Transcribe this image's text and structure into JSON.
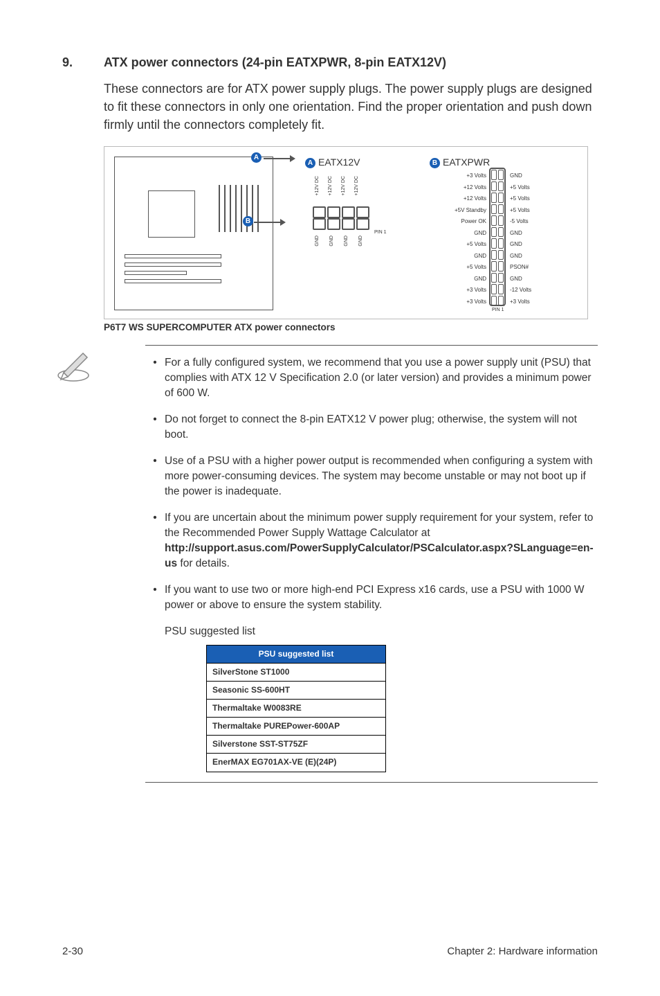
{
  "section": {
    "number": "9.",
    "title": "ATX power connectors (24-pin EATXPWR, 8-pin EATX12V)",
    "intro": "These connectors are for ATX power supply plugs. The power supply plugs are designed to fit these connectors in only one orientation. Find the proper orientation and push down firmly until the connectors completely fit."
  },
  "diagram": {
    "conn_a_label": "EATX12V",
    "conn_b_label": "EATXPWR",
    "badge_a": "A",
    "badge_b": "B",
    "pin1": "PIN 1",
    "eatx12v_top": [
      "+12V DC",
      "+12V DC",
      "+12V DC",
      "+12V DC"
    ],
    "eatx12v_bot": [
      "GND",
      "GND",
      "GND",
      "GND"
    ],
    "eatxpwr_left": [
      "+3 Volts",
      "+12 Volts",
      "+12 Volts",
      "+5V Standby",
      "Power OK",
      "GND",
      "+5 Volts",
      "GND",
      "+5 Volts",
      "GND",
      "+3 Volts",
      "+3 Volts"
    ],
    "eatxpwr_right": [
      "GND",
      "+5 Volts",
      "+5 Volts",
      "+5 Volts",
      "-5 Volts",
      "GND",
      "GND",
      "GND",
      "PSON#",
      "GND",
      "-12 Volts",
      "+3 Volts"
    ],
    "caption": "P6T7 WS SUPERCOMPUTER ATX power connectors"
  },
  "notes": [
    "For a fully configured system, we recommend that you use a power supply unit (PSU) that complies with ATX 12 V Specification 2.0 (or later version) and provides a minimum power of 600 W.",
    "Do not forget to connect the 8-pin EATX12 V power plug; otherwise, the system will not boot.",
    "Use of a PSU with a higher power output is recommended when configuring a system with more power-consuming devices. The system may become unstable or may not boot up if the power is inadequate.",
    {
      "pre": "If you are uncertain about the minimum power supply requirement for your system, refer to the Recommended Power Supply Wattage Calculator at ",
      "bold": "http://support.asus.com/PowerSupplyCalculator/PSCalculator.aspx?SLanguage=en-us",
      "post": " for details."
    },
    "If you want to use two or more high-end PCI Express x16 cards, use a PSU with 1000 W power or above to ensure the system stability."
  ],
  "psu": {
    "caption": "PSU suggested list",
    "header": "PSU suggested list",
    "rows": [
      "SilverStone ST1000",
      "Seasonic SS-600HT",
      "Thermaltake W0083RE",
      "Thermaltake PUREPower-600AP",
      "Silverstone SST-ST75ZF",
      "EnerMAX EG701AX-VE (E)(24P)"
    ]
  },
  "footer": {
    "left": "2-30",
    "right": "Chapter 2: Hardware information"
  }
}
